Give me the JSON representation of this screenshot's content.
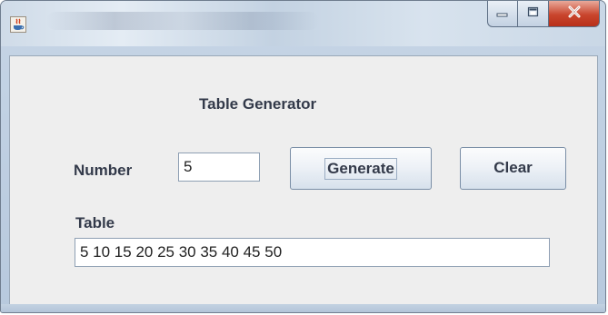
{
  "window": {
    "title": ""
  },
  "app": {
    "heading": "Table Generator",
    "number_label": "Number",
    "number_value": "5",
    "generate_label": "Generate",
    "clear_label": "Clear",
    "table_label": "Table",
    "table_value": "5  10  15  20  25  30  35  40  45  50"
  },
  "icons": {
    "app": "java-cup-icon",
    "minimize": "minimize-icon",
    "maximize": "maximize-icon",
    "close": "close-icon"
  }
}
